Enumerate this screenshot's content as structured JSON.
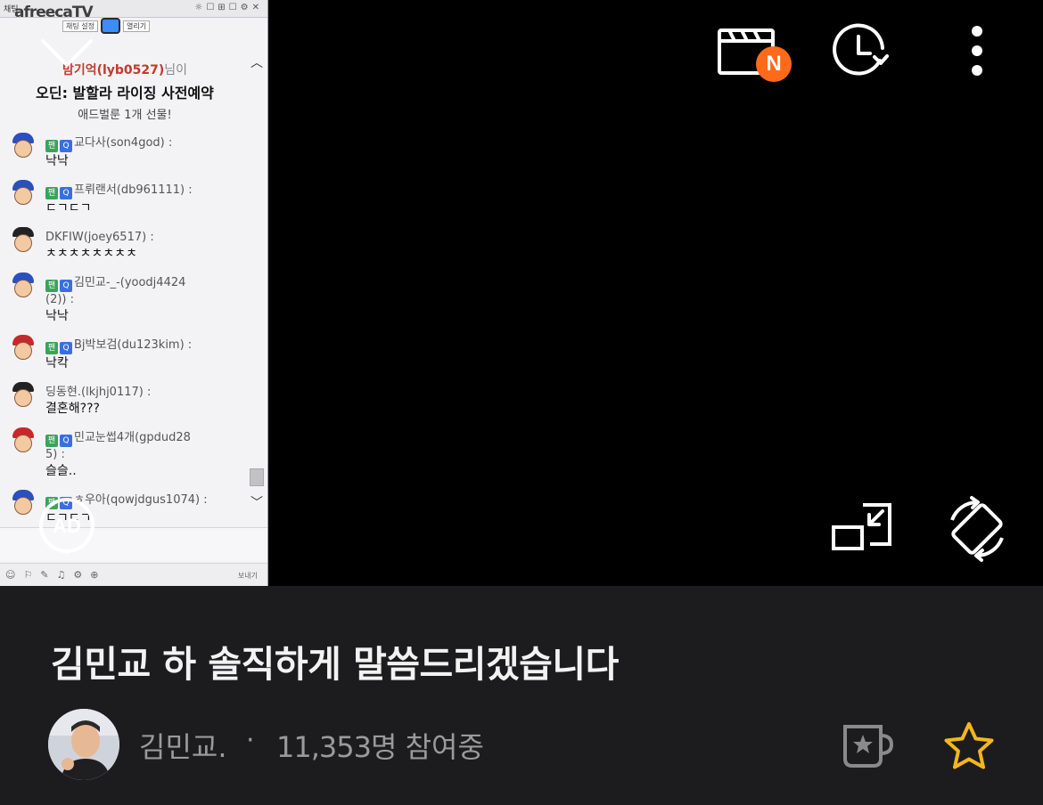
{
  "chat": {
    "window_title": "채팅",
    "brand": "afreecaTV",
    "select_label": "채팅 설정",
    "open_button": "열리기",
    "gift": {
      "user": "밤기억(lyb0527)",
      "user_suffix": "님이",
      "title": "오딘: 발할라 라이징 사전예약",
      "subtitle": "애드벌룬 1개 선물!"
    },
    "messages": [
      {
        "avatar": "blue",
        "badges": true,
        "user": "교다사(son4god) :",
        "text": "낙낙"
      },
      {
        "avatar": "blue",
        "badges": true,
        "user": "프뤼랜서(db961111) :",
        "text": "ㄷㄱㄷㄱ"
      },
      {
        "avatar": "black",
        "badges": false,
        "user": "DKFIW(joey6517) :",
        "text": "ㅊㅊㅊㅊㅊㅊㅊㅊ"
      },
      {
        "avatar": "blue",
        "badges": true,
        "user": "김민교-_-(yoodj4424",
        "user2": "(2)) :",
        "text": "낙낙"
      },
      {
        "avatar": "red",
        "badges": true,
        "user": "Bj박보검(du123kim) :",
        "text": "낙칵"
      },
      {
        "avatar": "black",
        "badges": false,
        "user": "딩동현.(lkjhj0117) :",
        "text": "결혼해???"
      },
      {
        "avatar": "red",
        "badges": true,
        "user": "민교눈썹4개(gpdud28",
        "user2": "5) :",
        "text": "슬슬.."
      },
      {
        "avatar": "blue",
        "badges": true,
        "user": "ㅎ우아(qowjdgus1074) :",
        "text": "ㄷㄱㄷㄱ"
      }
    ],
    "send_label": "보내기",
    "badge_fan": "팬",
    "badge_q": "Q"
  },
  "controls": {
    "ad_label": "AD",
    "clip_badge": "N"
  },
  "stream": {
    "title": "김민교 하 솔직하게 말씀드리겠습니다",
    "streamer": "김민교.",
    "separator": "·",
    "viewer_count": "11,353명",
    "viewer_suffix": "참여중"
  },
  "colors": {
    "accent_orange": "#ff6a1a",
    "star_yellow": "#f5b51c",
    "panel_bg": "#1c1c1e",
    "meta_gray": "#9a9a9c"
  }
}
